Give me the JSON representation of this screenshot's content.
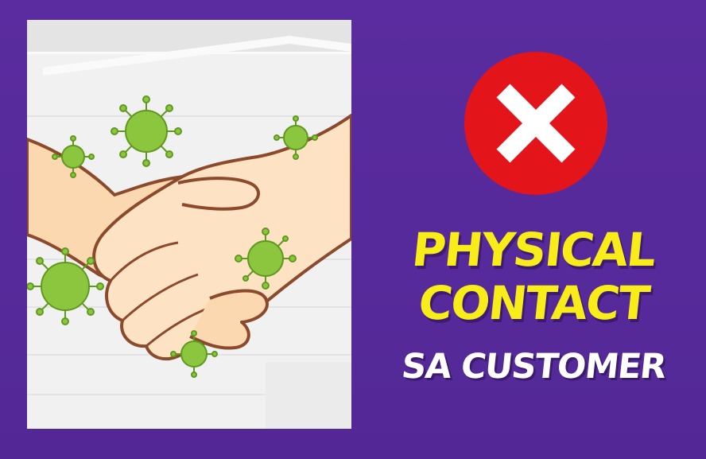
{
  "colors": {
    "background": "#552a99",
    "headline_yellow": "#f8ec19",
    "headline_white": "#ffffff",
    "prohibition_red": "#e3151b",
    "virus_green": "#8cc63f",
    "skin": "#fbd9b2",
    "outline": "#8b4a2b"
  },
  "illustration": {
    "subject_icon": "handshake-with-germs-icon"
  },
  "prohibition": {
    "icon": "x-mark-icon"
  },
  "headline": {
    "line1": "PHYSICAL",
    "line2": "CONTACT",
    "line3": "SA CUSTOMER"
  }
}
